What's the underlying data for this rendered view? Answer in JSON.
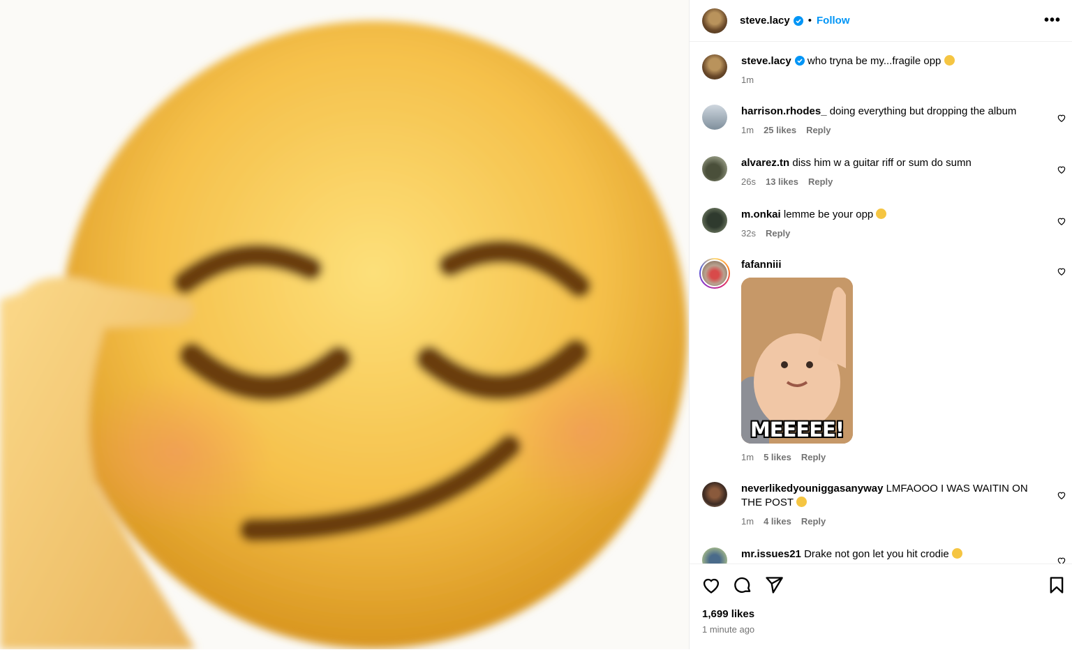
{
  "post": {
    "author": "steve.lacy",
    "follow_label": "Follow",
    "dot": "•",
    "more_label": "•••",
    "media_description": "smirking emoji close-up"
  },
  "caption": {
    "username": "steve.lacy",
    "text": "who tryna be my...fragile opp",
    "time": "1m"
  },
  "comments": [
    {
      "username": "harrison.rhodes_",
      "text": "doing everything but dropping the album",
      "time": "1m",
      "likes": "25 likes",
      "reply": "Reply"
    },
    {
      "username": "alvarez.tn",
      "text": "diss him w a guitar riff or sum do sumn",
      "time": "26s",
      "likes": "13 likes",
      "reply": "Reply"
    },
    {
      "username": "m.onkai",
      "text": "lemme be your opp",
      "time": "32s",
      "likes": "",
      "reply": "Reply"
    },
    {
      "username": "fafanniii",
      "text": "",
      "gif_caption": "MEEEEE!",
      "time": "1m",
      "likes": "5 likes",
      "reply": "Reply"
    },
    {
      "username": "neverlikedyouniggasanyway",
      "text": "LMFAOOO I WAS WAITIN ON THE POST",
      "time": "1m",
      "likes": "4 likes",
      "reply": "Reply"
    },
    {
      "username": "mr.issues21",
      "text": "Drake not gon let you hit crodie",
      "time": "",
      "likes": "",
      "reply": ""
    }
  ],
  "footer": {
    "likes": "1,699 likes",
    "time_ago": "1 minute ago"
  },
  "colors": {
    "accent": "#0095f6",
    "muted": "#737373",
    "verified": "#0095f6"
  }
}
